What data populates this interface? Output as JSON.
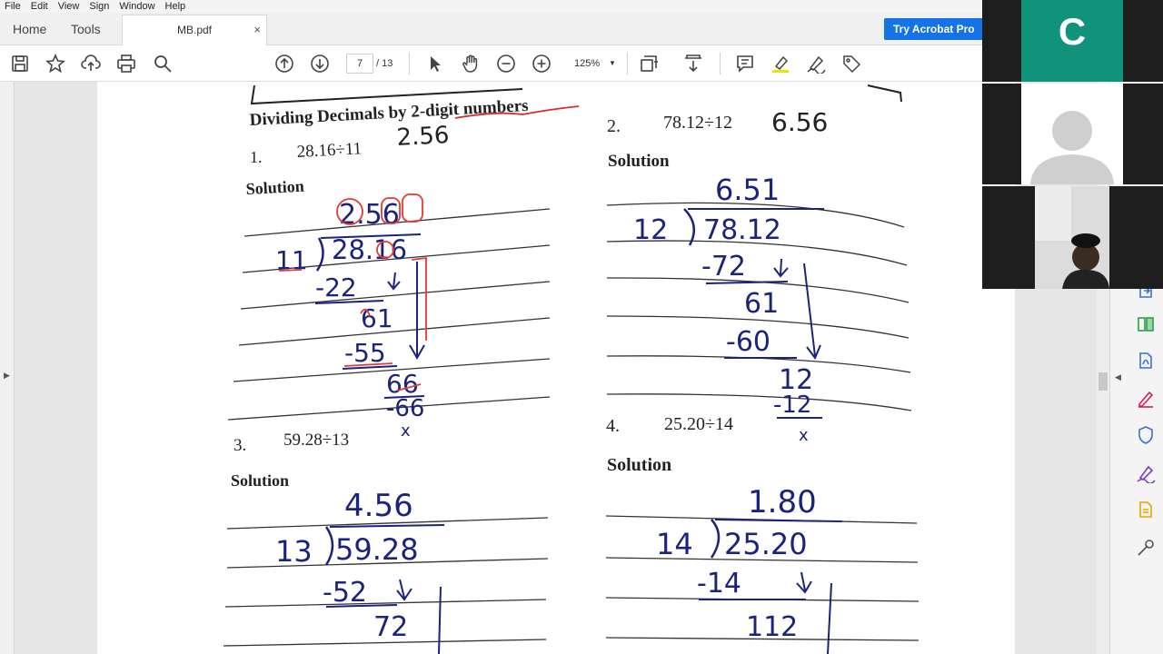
{
  "menu": [
    "File",
    "Edit",
    "View",
    "Sign",
    "Window",
    "Help"
  ],
  "nav": {
    "home": "Home",
    "tools": "Tools"
  },
  "document_tab": {
    "name": "MB.pdf",
    "close": "×"
  },
  "promo_button": "Try Acrobat Pro",
  "toolbar": {
    "icons": [
      "save-icon",
      "bookmark-star-icon",
      "upload-cloud-icon",
      "print-icon",
      "search-icon",
      "page-up-icon",
      "page-down-icon",
      "select-arrow-icon",
      "hand-icon",
      "zoom-out-icon",
      "zoom-in-icon",
      "fit-page-icon",
      "scroll-mode-icon",
      "comment-icon",
      "highlight-icon",
      "sign-icon",
      "tag-icon"
    ],
    "page_current": "7",
    "page_total": "/ 13",
    "zoom": "125%"
  },
  "worksheet": {
    "title": "Dividing Decimals by 2-digit numbers",
    "problems": [
      {
        "number": "1.",
        "question": "28.16÷11",
        "answer": "2.56",
        "solution_label": "Solution",
        "work": {
          "quotient": "2.56",
          "divisor": "11",
          "dividend": "28.16",
          "steps": [
            "-22",
            "61",
            "-55",
            "66",
            "-66",
            "x"
          ]
        }
      },
      {
        "number": "2.",
        "question": "78.12÷12",
        "answer": "6.56",
        "solution_label": "Solution",
        "work": {
          "quotient": "6.51",
          "divisor": "12",
          "dividend": "78.12",
          "steps": [
            "-72",
            "61",
            "-60",
            "12",
            "-12",
            "x"
          ]
        }
      },
      {
        "number": "3.",
        "question": "59.28÷13",
        "answer": "",
        "solution_label": "Solution",
        "work": {
          "quotient": "4.56",
          "divisor": "13",
          "dividend": "59.28",
          "steps": [
            "-52",
            "72"
          ]
        }
      },
      {
        "number": "4.",
        "question": "25.20÷14",
        "answer": "",
        "solution_label": "Solution",
        "work": {
          "quotient": "1.80",
          "divisor": "14",
          "dividend": "25.20",
          "steps": [
            "-14",
            "112"
          ]
        }
      }
    ]
  },
  "video_call": {
    "participant_initial": "C"
  },
  "right_tools": [
    "export-pdf-icon",
    "organize-pages-icon",
    "create-pdf-icon",
    "edit-pdf-icon",
    "protect-icon",
    "fill-sign-icon",
    "send-for-review-icon",
    "more-tools-icon"
  ],
  "colors": {
    "accent": "#1473e6",
    "ink": "#1a237e",
    "correction": "#e53935",
    "avatar": "#10937a"
  }
}
